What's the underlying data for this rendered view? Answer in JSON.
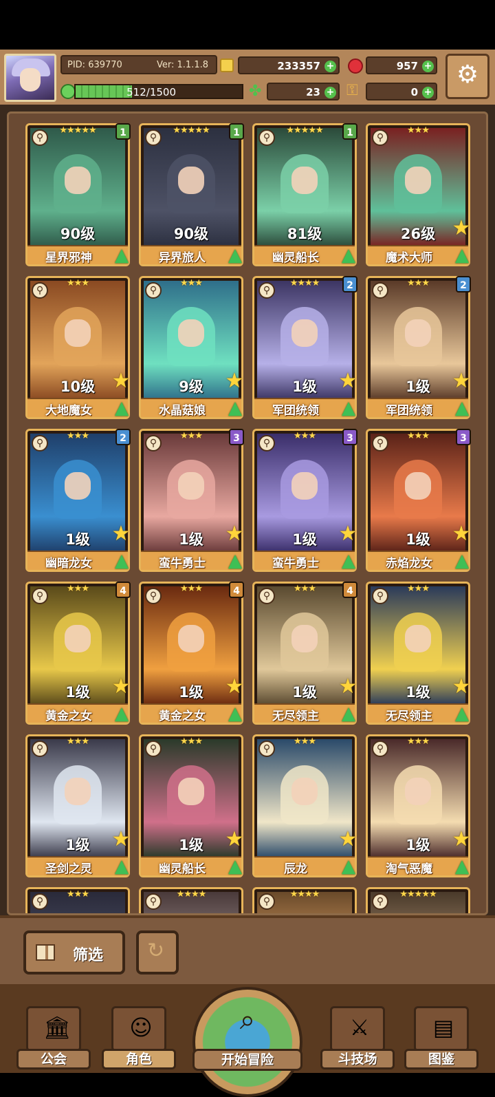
{
  "hud": {
    "pid": "PID: 639770",
    "version": "Ver: 1.1.1.8",
    "gold": "233357",
    "gems": "957",
    "xp": "512/1500",
    "xp_fraction": 0.34,
    "clover": "23",
    "keys": "0"
  },
  "colors": {
    "badge_green": "#59a84a",
    "badge_blue": "#4a8fd1",
    "badge_purple": "#8a5ac8",
    "badge_orange": "#d08a3a"
  },
  "roster": [
    {
      "name": "星界邪神",
      "level": "90级",
      "stars": "★★★★★",
      "badge": "1",
      "badge_color": "#59a84a",
      "star_ready": false,
      "art": [
        "#2f5a4a",
        "#5fb08c"
      ]
    },
    {
      "name": "异界旅人",
      "level": "90级",
      "stars": "★★★★★",
      "badge": "1",
      "badge_color": "#59a84a",
      "star_ready": false,
      "art": [
        "#2c3040",
        "#4e5266"
      ]
    },
    {
      "name": "幽灵船长",
      "level": "81级",
      "stars": "★★★★★",
      "badge": "1",
      "badge_color": "#59a84a",
      "star_ready": false,
      "art": [
        "#2b4a3a",
        "#7bd0a8"
      ]
    },
    {
      "name": "魔术大师",
      "level": "26级",
      "stars": "★★★",
      "badge": "",
      "badge_color": "",
      "star_ready": true,
      "art": [
        "#7a2020",
        "#5fc09a"
      ]
    },
    {
      "name": "大地魔女",
      "level": "10级",
      "stars": "★★★",
      "badge": "",
      "badge_color": "",
      "star_ready": true,
      "art": [
        "#8a4a22",
        "#e2a45a"
      ]
    },
    {
      "name": "水晶菇娘",
      "level": "9级",
      "stars": "★★★",
      "badge": "",
      "badge_color": "",
      "star_ready": true,
      "art": [
        "#2f6f8a",
        "#6fe0c0"
      ]
    },
    {
      "name": "军团统领",
      "level": "1级",
      "stars": "★★★★",
      "badge": "2",
      "badge_color": "#4a8fd1",
      "star_ready": true,
      "art": [
        "#3c3563",
        "#b6b0e8"
      ]
    },
    {
      "name": "军团统领",
      "level": "1级",
      "stars": "★★★",
      "badge": "2",
      "badge_color": "#4a8fd1",
      "star_ready": true,
      "art": [
        "#5a3a28",
        "#e8c79a"
      ]
    },
    {
      "name": "幽暗龙女",
      "level": "1级",
      "stars": "★★★",
      "badge": "2",
      "badge_color": "#4a8fd1",
      "star_ready": true,
      "art": [
        "#1f3f6a",
        "#3a8fd0"
      ]
    },
    {
      "name": "蛮牛勇士",
      "level": "1级",
      "stars": "★★★",
      "badge": "3",
      "badge_color": "#8a5ac8",
      "star_ready": true,
      "art": [
        "#6a3a3a",
        "#e8a8a0"
      ]
    },
    {
      "name": "蛮牛勇士",
      "level": "1级",
      "stars": "★★★",
      "badge": "3",
      "badge_color": "#8a5ac8",
      "star_ready": true,
      "art": [
        "#3a2e6a",
        "#a89ae0"
      ]
    },
    {
      "name": "赤焰龙女",
      "level": "1级",
      "stars": "★★★",
      "badge": "3",
      "badge_color": "#8a5ac8",
      "star_ready": true,
      "art": [
        "#5a2218",
        "#e87a4a"
      ]
    },
    {
      "name": "黄金之女",
      "level": "1级",
      "stars": "★★★",
      "badge": "4",
      "badge_color": "#d08a3a",
      "star_ready": true,
      "art": [
        "#5a4a1a",
        "#e8c84a"
      ]
    },
    {
      "name": "黄金之女",
      "level": "1级",
      "stars": "★★★",
      "badge": "4",
      "badge_color": "#d08a3a",
      "star_ready": true,
      "art": [
        "#6a2a10",
        "#f0a040"
      ]
    },
    {
      "name": "无尽领主",
      "level": "1级",
      "stars": "★★★",
      "badge": "4",
      "badge_color": "#d08a3a",
      "star_ready": true,
      "art": [
        "#5a4a30",
        "#e0c89a"
      ]
    },
    {
      "name": "无尽领主",
      "level": "1级",
      "stars": "★★★",
      "badge": "",
      "badge_color": "",
      "star_ready": true,
      "art": [
        "#2a3a5a",
        "#f0d050"
      ]
    },
    {
      "name": "圣剑之灵",
      "level": "1级",
      "stars": "★★★",
      "badge": "",
      "badge_color": "",
      "star_ready": true,
      "art": [
        "#3a3a4a",
        "#dfe6f0"
      ]
    },
    {
      "name": "幽灵船长",
      "level": "1级",
      "stars": "★★★",
      "badge": "",
      "badge_color": "",
      "star_ready": true,
      "art": [
        "#2a3a2a",
        "#d0708a"
      ]
    },
    {
      "name": "辰龙",
      "level": "",
      "stars": "★★★",
      "badge": "",
      "badge_color": "",
      "star_ready": true,
      "art": [
        "#2a4a6a",
        "#f0e6c8"
      ]
    },
    {
      "name": "淘气恶魔",
      "level": "1级",
      "stars": "★★★",
      "badge": "",
      "badge_color": "",
      "star_ready": true,
      "art": [
        "#4a2a2a",
        "#f4dcb0"
      ]
    },
    {
      "name": "",
      "level": "",
      "stars": "★★★",
      "badge": "",
      "badge_color": "",
      "star_ready": false,
      "art": [
        "#2a2a3a",
        "#555a70"
      ]
    },
    {
      "name": "",
      "level": "",
      "stars": "★★★★",
      "badge": "",
      "badge_color": "",
      "star_ready": false,
      "art": [
        "#4a3a3a",
        "#b0a0a0"
      ]
    },
    {
      "name": "",
      "level": "",
      "stars": "★★★★",
      "badge": "",
      "badge_color": "",
      "star_ready": false,
      "art": [
        "#6a4a2a",
        "#f0b070"
      ]
    },
    {
      "name": "",
      "level": "",
      "stars": "★★★★★",
      "badge": "",
      "badge_color": "",
      "star_ready": false,
      "art": [
        "#4a3a2a",
        "#c0a080"
      ]
    }
  ],
  "controls": {
    "filter_label": "筛选"
  },
  "nav": {
    "guild": "公会",
    "role": "角色",
    "adventure": "开始冒险",
    "arena": "斗技场",
    "codex": "图鉴"
  }
}
